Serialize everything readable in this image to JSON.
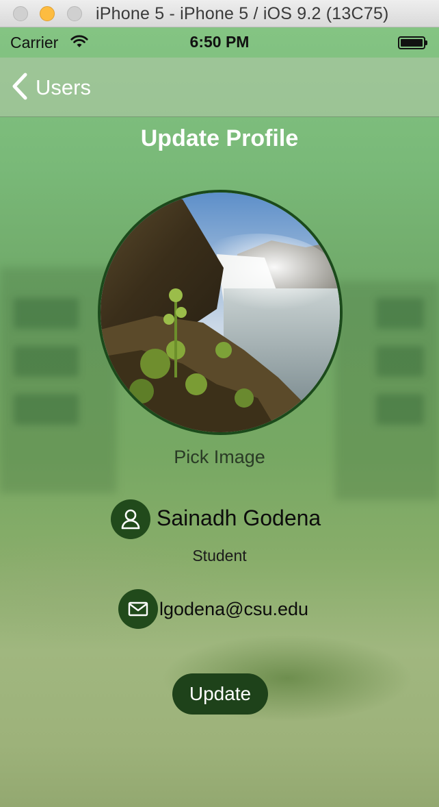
{
  "window": {
    "title": "iPhone 5 - iPhone 5 / iOS 9.2 (13C75)"
  },
  "status_bar": {
    "carrier": "Carrier",
    "time": "6:50 PM",
    "wifi_icon": "wifi-icon",
    "battery_icon": "battery-icon",
    "battery_level": 1.0
  },
  "nav": {
    "back_label": "Users",
    "back_icon": "chevron-left-icon"
  },
  "page": {
    "title": "Update Profile",
    "pick_image_label": "Pick Image"
  },
  "profile": {
    "name": "Sainadh Godena",
    "role": "Student",
    "email": "lgodena@csu.edu",
    "name_icon": "user-icon",
    "email_icon": "mail-icon"
  },
  "actions": {
    "update_label": "Update"
  },
  "colors": {
    "accent_dark_green": "#1e421a",
    "avatar_border": "#1b4a1b",
    "background_green": "#79b978"
  }
}
